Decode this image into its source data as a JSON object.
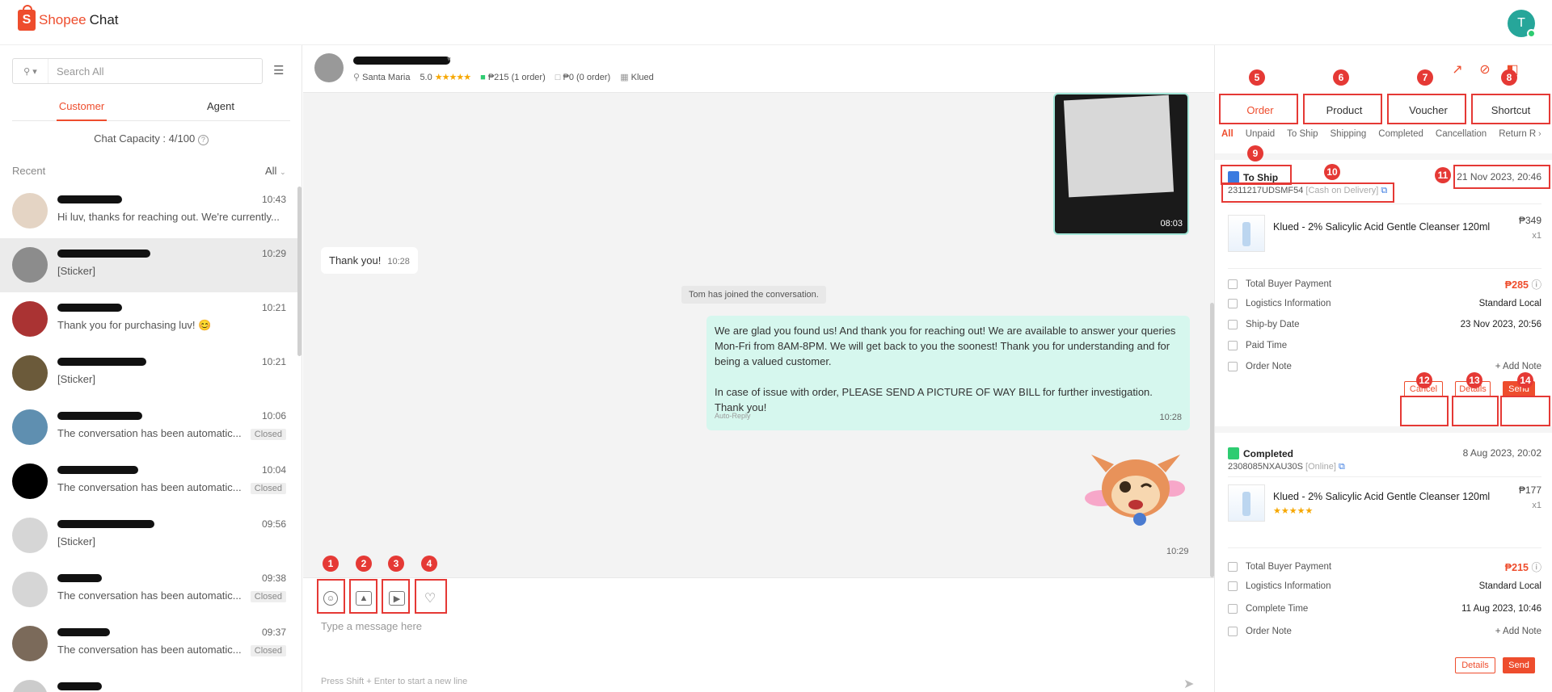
{
  "app": {
    "brand": "Shopee",
    "product": "Chat",
    "user_initial": "T"
  },
  "sidebar": {
    "search_placeholder": "Search All",
    "tabs": [
      {
        "label": "Customer"
      },
      {
        "label": "Agent"
      }
    ],
    "capacity": "Chat Capacity : 4/100",
    "recent_label": "Recent",
    "recent_filter": "All",
    "conversations": [
      {
        "time": "10:43",
        "message": "Hi luv, thanks for reaching out. We're currently...",
        "badge": ""
      },
      {
        "time": "10:29",
        "message": "[Sticker]",
        "badge": ""
      },
      {
        "time": "10:21",
        "message": "Thank you for purchasing luv! 😊",
        "badge": ""
      },
      {
        "time": "10:21",
        "message": "[Sticker]",
        "badge": ""
      },
      {
        "time": "10:06",
        "message": "The conversation has been automatic...",
        "badge": "Closed"
      },
      {
        "time": "10:04",
        "message": "The conversation has been automatic...",
        "badge": "Closed"
      },
      {
        "time": "09:56",
        "message": "[Sticker]",
        "badge": ""
      },
      {
        "time": "09:38",
        "message": "The conversation has been automatic...",
        "badge": "Closed"
      },
      {
        "time": "09:37",
        "message": "The conversation has been automatic...",
        "badge": "Closed"
      }
    ]
  },
  "chat": {
    "header": {
      "location": "Santa Maria",
      "rating": "5.0",
      "orders_paid": "₱215 (1 order)",
      "orders_unpaid": "₱0 (0 order)",
      "shop": "Klued"
    },
    "video_duration": "08:03",
    "thank_you": {
      "text": "Thank you!",
      "time": "10:28"
    },
    "system": "Tom has joined the conversation.",
    "auto_reply": {
      "p1": "We are glad you found us! And thank you for reaching out! We are available to answer your queries Mon-Fri from 8AM-8PM. We will get back to you the soonest! Thank you for understanding and for being a valued customer.",
      "p2": "In case of issue with order, PLEASE SEND A PICTURE OF WAY BILL for further investigation. Thank you!",
      "tag": "Auto-Reply",
      "time": "10:28"
    },
    "sticker_time": "10:29",
    "input_placeholder": "Type a message here",
    "hint": "Press Shift + Enter to start a new line"
  },
  "annotations": [
    "1",
    "2",
    "3",
    "4",
    "5",
    "6",
    "7",
    "8",
    "9",
    "10",
    "11",
    "12",
    "13",
    "14"
  ],
  "panel": {
    "tabs": [
      {
        "label": "Order"
      },
      {
        "label": "Product"
      },
      {
        "label": "Voucher"
      },
      {
        "label": "Shortcut"
      }
    ],
    "subtabs": [
      "All",
      "Unpaid",
      "To Ship",
      "Shipping",
      "Completed",
      "Cancellation",
      "Return R"
    ],
    "orders": [
      {
        "status": "To Ship",
        "date": "21 Nov 2023, 20:46",
        "number": "2311217UDSMF54",
        "payment": "[Cash on Delivery]",
        "product": "Klued - 2% Salicylic Acid Gentle Cleanser 120ml",
        "price": "₱349",
        "qty": "x1",
        "rows": [
          {
            "label": "Total Buyer Payment",
            "value": "₱285"
          },
          {
            "label": "Logistics Information",
            "value": "Standard Local"
          },
          {
            "label": "Ship-by Date",
            "value": "23 Nov 2023, 20:56"
          },
          {
            "label": "Paid Time",
            "value": ""
          },
          {
            "label": "Order Note",
            "value": "+ Add Note"
          }
        ],
        "btn_cancel": "Cancel",
        "btn_details": "Details",
        "btn_send": "Send"
      },
      {
        "status": "Completed",
        "date": "8 Aug 2023, 20:02",
        "number": "2308085NXAU30S",
        "payment": "[Online]",
        "product": "Klued - 2% Salicylic Acid Gentle Cleanser 120ml",
        "price": "₱177",
        "qty": "x1",
        "rating": "★★★★★",
        "rows": [
          {
            "label": "Total Buyer Payment",
            "value": "₱215"
          },
          {
            "label": "Logistics Information",
            "value": "Standard Local"
          },
          {
            "label": "Complete Time",
            "value": "11 Aug 2023, 10:46"
          },
          {
            "label": "Order Note",
            "value": "+ Add Note"
          }
        ],
        "btn_details": "Details",
        "btn_send": "Send"
      }
    ]
  },
  "colors": {
    "accent": "#ee4d2d",
    "annotation": "#e53935",
    "reply_bg": "#d6f7ee"
  }
}
